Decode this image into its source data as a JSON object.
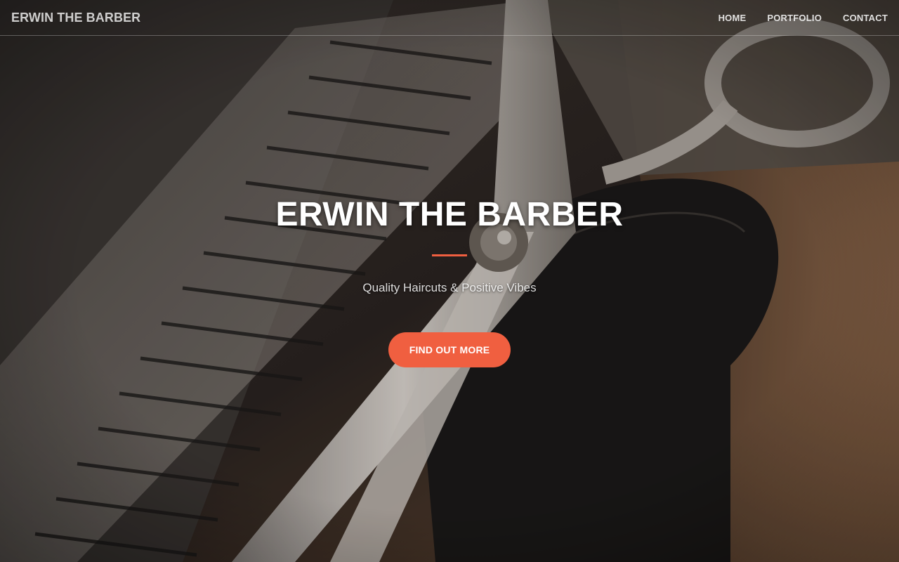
{
  "brand": "ERWIN THE BARBER",
  "nav": {
    "home": "HOME",
    "portfolio": "PORTFOLIO",
    "contact": "CONTACT"
  },
  "hero": {
    "title": "ERWIN THE BARBER",
    "subtitle": "Quality Haircuts & Positive Vibes",
    "cta_label": "FIND OUT MORE"
  },
  "colors": {
    "accent": "#f05f40",
    "text": "#ffffff"
  }
}
